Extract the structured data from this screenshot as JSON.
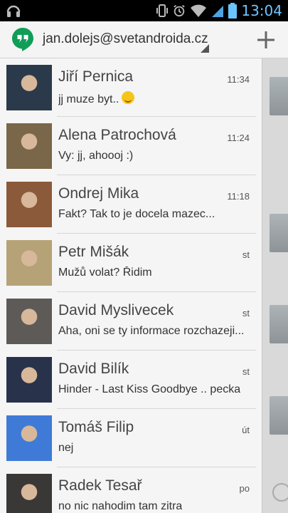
{
  "status_bar": {
    "time": "13:04",
    "icons": [
      "headphones-icon",
      "vibrate-icon",
      "alarm-icon",
      "wifi-icon",
      "signal-icon",
      "battery-icon"
    ]
  },
  "action_bar": {
    "account": "jan.dolejs@svetandroida.cz",
    "app_icon": "hangouts-icon",
    "add_icon": "plus-icon"
  },
  "conversations": [
    {
      "name": "Jiří Pernica",
      "time": "11:34",
      "preview": "jj muze byt..",
      "emoji": "smiley-emoji",
      "avatar_color": "#2a3a4a"
    },
    {
      "name": "Alena Patrochová",
      "time": "11:24",
      "preview": "Vy: jj, ahoooj :)",
      "avatar_color": "#7a6648"
    },
    {
      "name": "Ondrej Mika",
      "time": "11:18",
      "preview": "Fakt? Tak to je docela mazec...",
      "avatar_color": "#8a5a3a"
    },
    {
      "name": "Petr Mišák",
      "time": "st",
      "preview": "Mužů volat? Řidim",
      "avatar_color": "#b6a277"
    },
    {
      "name": "David Myslivecek",
      "time": "st",
      "preview": "Aha, oni se ty informace rozchazeji...",
      "avatar_color": "#5e5a58"
    },
    {
      "name": "David Bilík",
      "time": "st",
      "preview": "Hinder - Last Kiss Goodbye .. pecka",
      "avatar_color": "#28324a"
    },
    {
      "name": "Tomáš Filip",
      "time": "út",
      "preview": "nej",
      "avatar_color": "#3f7bd6"
    },
    {
      "name": "Radek Tesař",
      "time": "po",
      "preview": "no nic nahodim tam zitra",
      "avatar_color": "#3a3836"
    }
  ]
}
